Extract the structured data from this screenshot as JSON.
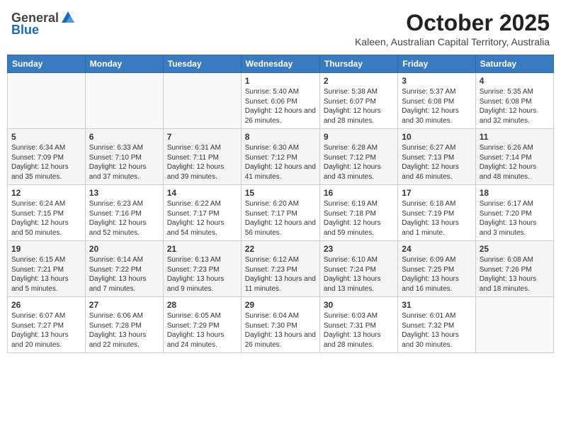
{
  "header": {
    "logo_general": "General",
    "logo_blue": "Blue",
    "title": "October 2025",
    "subtitle": "Kaleen, Australian Capital Territory, Australia"
  },
  "weekdays": [
    "Sunday",
    "Monday",
    "Tuesday",
    "Wednesday",
    "Thursday",
    "Friday",
    "Saturday"
  ],
  "weeks": [
    [
      {
        "day": "",
        "info": ""
      },
      {
        "day": "",
        "info": ""
      },
      {
        "day": "",
        "info": ""
      },
      {
        "day": "1",
        "info": "Sunrise: 5:40 AM\nSunset: 6:06 PM\nDaylight: 12 hours and 26 minutes."
      },
      {
        "day": "2",
        "info": "Sunrise: 5:38 AM\nSunset: 6:07 PM\nDaylight: 12 hours and 28 minutes."
      },
      {
        "day": "3",
        "info": "Sunrise: 5:37 AM\nSunset: 6:08 PM\nDaylight: 12 hours and 30 minutes."
      },
      {
        "day": "4",
        "info": "Sunrise: 5:35 AM\nSunset: 6:08 PM\nDaylight: 12 hours and 32 minutes."
      }
    ],
    [
      {
        "day": "5",
        "info": "Sunrise: 6:34 AM\nSunset: 7:09 PM\nDaylight: 12 hours and 35 minutes."
      },
      {
        "day": "6",
        "info": "Sunrise: 6:33 AM\nSunset: 7:10 PM\nDaylight: 12 hours and 37 minutes."
      },
      {
        "day": "7",
        "info": "Sunrise: 6:31 AM\nSunset: 7:11 PM\nDaylight: 12 hours and 39 minutes."
      },
      {
        "day": "8",
        "info": "Sunrise: 6:30 AM\nSunset: 7:12 PM\nDaylight: 12 hours and 41 minutes."
      },
      {
        "day": "9",
        "info": "Sunrise: 6:28 AM\nSunset: 7:12 PM\nDaylight: 12 hours and 43 minutes."
      },
      {
        "day": "10",
        "info": "Sunrise: 6:27 AM\nSunset: 7:13 PM\nDaylight: 12 hours and 46 minutes."
      },
      {
        "day": "11",
        "info": "Sunrise: 6:26 AM\nSunset: 7:14 PM\nDaylight: 12 hours and 48 minutes."
      }
    ],
    [
      {
        "day": "12",
        "info": "Sunrise: 6:24 AM\nSunset: 7:15 PM\nDaylight: 12 hours and 50 minutes."
      },
      {
        "day": "13",
        "info": "Sunrise: 6:23 AM\nSunset: 7:16 PM\nDaylight: 12 hours and 52 minutes."
      },
      {
        "day": "14",
        "info": "Sunrise: 6:22 AM\nSunset: 7:17 PM\nDaylight: 12 hours and 54 minutes."
      },
      {
        "day": "15",
        "info": "Sunrise: 6:20 AM\nSunset: 7:17 PM\nDaylight: 12 hours and 56 minutes."
      },
      {
        "day": "16",
        "info": "Sunrise: 6:19 AM\nSunset: 7:18 PM\nDaylight: 12 hours and 59 minutes."
      },
      {
        "day": "17",
        "info": "Sunrise: 6:18 AM\nSunset: 7:19 PM\nDaylight: 13 hours and 1 minute."
      },
      {
        "day": "18",
        "info": "Sunrise: 6:17 AM\nSunset: 7:20 PM\nDaylight: 13 hours and 3 minutes."
      }
    ],
    [
      {
        "day": "19",
        "info": "Sunrise: 6:15 AM\nSunset: 7:21 PM\nDaylight: 13 hours and 5 minutes."
      },
      {
        "day": "20",
        "info": "Sunrise: 6:14 AM\nSunset: 7:22 PM\nDaylight: 13 hours and 7 minutes."
      },
      {
        "day": "21",
        "info": "Sunrise: 6:13 AM\nSunset: 7:23 PM\nDaylight: 13 hours and 9 minutes."
      },
      {
        "day": "22",
        "info": "Sunrise: 6:12 AM\nSunset: 7:23 PM\nDaylight: 13 hours and 11 minutes."
      },
      {
        "day": "23",
        "info": "Sunrise: 6:10 AM\nSunset: 7:24 PM\nDaylight: 13 hours and 13 minutes."
      },
      {
        "day": "24",
        "info": "Sunrise: 6:09 AM\nSunset: 7:25 PM\nDaylight: 13 hours and 16 minutes."
      },
      {
        "day": "25",
        "info": "Sunrise: 6:08 AM\nSunset: 7:26 PM\nDaylight: 13 hours and 18 minutes."
      }
    ],
    [
      {
        "day": "26",
        "info": "Sunrise: 6:07 AM\nSunset: 7:27 PM\nDaylight: 13 hours and 20 minutes."
      },
      {
        "day": "27",
        "info": "Sunrise: 6:06 AM\nSunset: 7:28 PM\nDaylight: 13 hours and 22 minutes."
      },
      {
        "day": "28",
        "info": "Sunrise: 6:05 AM\nSunset: 7:29 PM\nDaylight: 13 hours and 24 minutes."
      },
      {
        "day": "29",
        "info": "Sunrise: 6:04 AM\nSunset: 7:30 PM\nDaylight: 13 hours and 26 minutes."
      },
      {
        "day": "30",
        "info": "Sunrise: 6:03 AM\nSunset: 7:31 PM\nDaylight: 13 hours and 28 minutes."
      },
      {
        "day": "31",
        "info": "Sunrise: 6:01 AM\nSunset: 7:32 PM\nDaylight: 13 hours and 30 minutes."
      },
      {
        "day": "",
        "info": ""
      }
    ]
  ]
}
